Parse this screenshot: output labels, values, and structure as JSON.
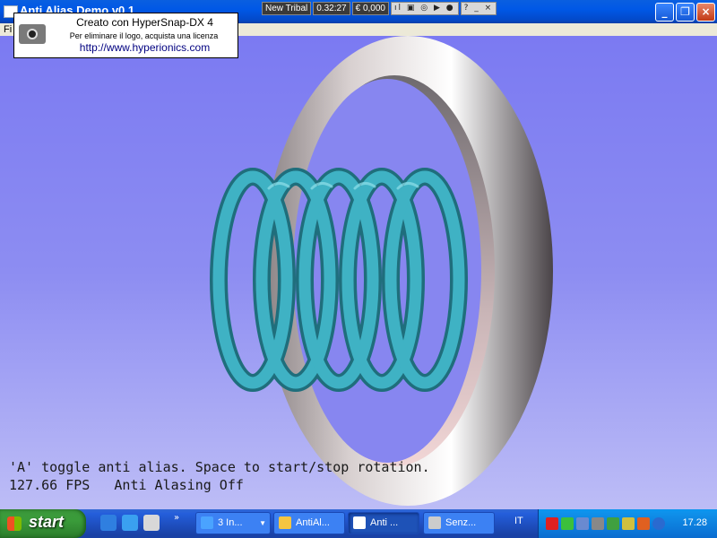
{
  "window": {
    "title": "Anti Alias Demo v0.1",
    "menu_file": "Fi"
  },
  "top_tray": {
    "brand": "New Tribal",
    "time": "0.32:27",
    "credit": "€ 0,000",
    "icons": "ıl ▣ ◎ ▶ ●",
    "help": "? _ ×"
  },
  "watermark": {
    "line1": "Creato con HyperSnap-DX 4",
    "line2": "Per eliminare il logo, acquista una licenza",
    "line3": "http://www.hyperionics.com"
  },
  "overlay": {
    "instructions": "'A' toggle anti alias. Space to start/stop rotation.",
    "status": "127.66 FPS   Anti Alasing Off"
  },
  "taskbar": {
    "start_label": "start",
    "tasks": [
      {
        "label": "3 In...",
        "icon": "ie-icon",
        "color": "#4aa3ff"
      },
      {
        "label": "AntiAl...",
        "icon": "folder-icon",
        "color": "#f5c542"
      },
      {
        "label": "Anti ...",
        "icon": "window-icon",
        "color": "#ffffff"
      },
      {
        "label": "Senz...",
        "icon": "camera-icon",
        "color": "#cccccc"
      }
    ],
    "language": "IT",
    "clock": "17.28"
  },
  "colors": {
    "background_top": "#7b7af2",
    "helix": "#3aa7b8",
    "torus_light": "#f0f0f0",
    "torus_pink": "#e8c8c8"
  }
}
